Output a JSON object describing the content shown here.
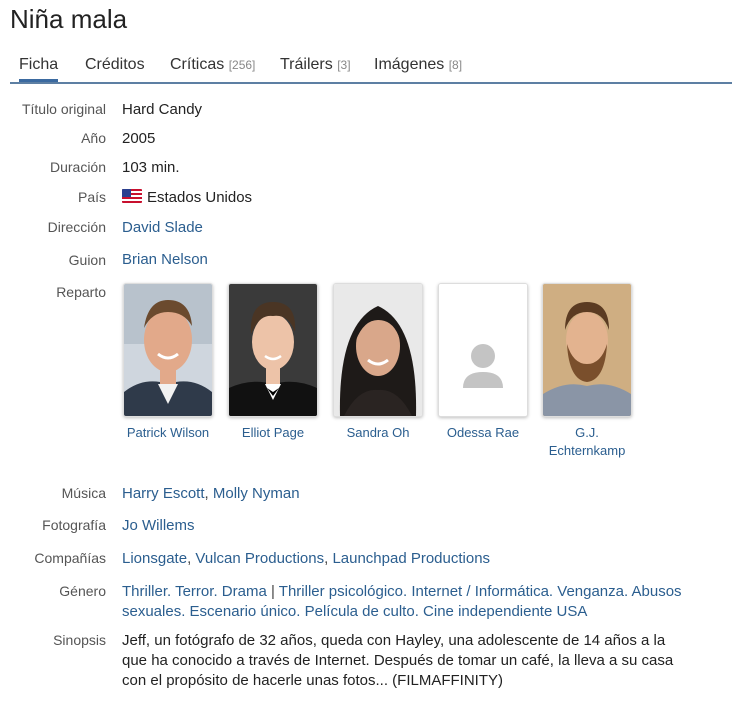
{
  "title": "Niña mala",
  "tabs": [
    {
      "label": "Ficha",
      "count": ""
    },
    {
      "label": "Créditos",
      "count": ""
    },
    {
      "label": "Críticas",
      "count": "[256]"
    },
    {
      "label": "Tráilers",
      "count": "[3]"
    },
    {
      "label": "Imágenes",
      "count": "[8]"
    }
  ],
  "labels": {
    "titulo_original": "Título original",
    "anio": "Año",
    "duracion": "Duración",
    "pais": "País",
    "direccion": "Dirección",
    "guion": "Guion",
    "reparto": "Reparto",
    "musica": "Música",
    "fotografia": "Fotografía",
    "companias": "Compañías",
    "genero": "Género",
    "sinopsis": "Sinopsis"
  },
  "values": {
    "titulo_original": "Hard Candy",
    "anio": "2005",
    "duracion": "103 min.",
    "pais": "Estados Unidos",
    "pais_flag": "us-flag-icon",
    "direccion": "David Slade",
    "guion": "Brian Nelson",
    "musica": [
      "Harry Escott",
      "Molly Nyman"
    ],
    "fotografia": "Jo Willems",
    "companias": [
      "Lionsgate",
      "Vulcan Productions",
      "Launchpad Productions"
    ],
    "genero_line1": [
      "Thriller",
      "Terror",
      "Drama"
    ],
    "genero_sep": "|",
    "genero_line1b": [
      "Thriller psicológico",
      "Internet / Informática",
      "Venganza",
      "Abusos"
    ],
    "genero_line2": [
      "sexuales",
      "Escenario único",
      "Película de culto",
      "Cine independiente USA"
    ],
    "sinopsis": [
      "Jeff, un fotógrafo de 32 años, queda con Hayley, una adolescente de 14 años a la",
      "que ha conocido a través de Internet. Después de tomar un café, la lleva a su casa",
      "con el propósito de hacerle unas fotos... (FILMAFFINITY)"
    ]
  },
  "cast": [
    {
      "name_lines": [
        "Patrick Wilson"
      ],
      "photo": "photo-icon"
    },
    {
      "name_lines": [
        "Elliot Page"
      ],
      "photo": "photo-icon"
    },
    {
      "name_lines": [
        "Sandra Oh"
      ],
      "photo": "photo-icon"
    },
    {
      "name_lines": [
        "Odessa Rae"
      ],
      "photo": "person-placeholder-icon"
    },
    {
      "name_lines": [
        "G.J.",
        "Echternkamp"
      ],
      "photo": "photo-icon"
    }
  ],
  "colors": {
    "link": "#2b5e8f",
    "tab_underline": "#3b6aa0"
  }
}
